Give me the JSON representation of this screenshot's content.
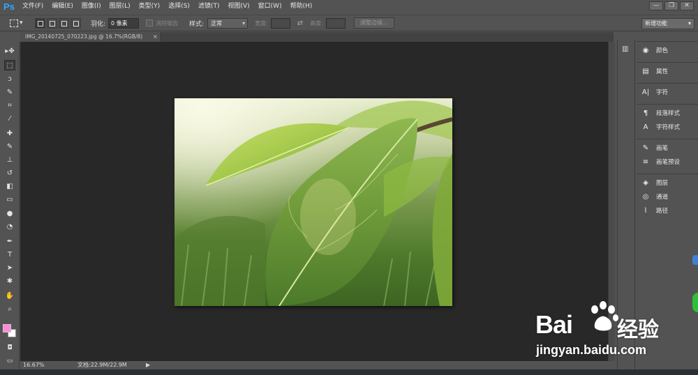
{
  "app": {
    "logo": "Ps"
  },
  "menubar": {
    "items": [
      "文件(F)",
      "编辑(E)",
      "图像(I)",
      "图层(L)",
      "类型(Y)",
      "选择(S)",
      "滤镜(T)",
      "视图(V)",
      "窗口(W)",
      "帮助(H)"
    ]
  },
  "window_controls": {
    "minimize": "—",
    "restore": "❐",
    "close": "✕"
  },
  "options": {
    "feather_label": "羽化:",
    "feather_value": "0 像素",
    "antialias_label": "消除锯齿",
    "style_label": "样式:",
    "style_value": "正常",
    "width_label": "宽度:",
    "height_label": "高度:",
    "refine_edge": "调整边缘...",
    "workspace": "新增功能"
  },
  "document": {
    "tab_title": "IMG_20140725_070223.jpg @ 16.7%(RGB/8)",
    "tab_close": "×"
  },
  "status": {
    "zoom": "16.67%",
    "doc_size": "文档:22.9M/22.9M",
    "arrow": "▶"
  },
  "panels": {
    "groups": [
      {
        "items": [
          {
            "icon": "palette-icon",
            "glyph": "◉",
            "label": "颜色"
          }
        ]
      },
      {
        "items": [
          {
            "icon": "properties-icon",
            "glyph": "▤",
            "label": "属性"
          }
        ]
      },
      {
        "items": [
          {
            "icon": "character-icon",
            "glyph": "A|",
            "label": "字符"
          }
        ]
      },
      {
        "items": [
          {
            "icon": "paragraph-style-icon",
            "glyph": "¶",
            "label": "段落样式"
          },
          {
            "icon": "character-style-icon",
            "glyph": "A",
            "label": "字符样式"
          }
        ]
      },
      {
        "items": [
          {
            "icon": "brush-icon",
            "glyph": "✎",
            "label": "画笔"
          },
          {
            "icon": "brush-presets-icon",
            "glyph": "≡",
            "label": "画笔预设"
          }
        ]
      },
      {
        "items": [
          {
            "icon": "layers-icon",
            "glyph": "◈",
            "label": "图层"
          },
          {
            "icon": "channels-icon",
            "glyph": "◎",
            "label": "通道"
          },
          {
            "icon": "paths-icon",
            "glyph": "⌇",
            "label": "路径"
          }
        ]
      }
    ]
  },
  "tools": [
    {
      "icon": "move-tool-icon",
      "glyph": "▸✥"
    },
    {
      "icon": "marquee-tool-icon",
      "glyph": "⬚"
    },
    {
      "icon": "lasso-tool-icon",
      "glyph": "ↄ"
    },
    {
      "icon": "quick-select-tool-icon",
      "glyph": "✎"
    },
    {
      "icon": "crop-tool-icon",
      "glyph": "⌗"
    },
    {
      "icon": "eyedropper-tool-icon",
      "glyph": "⁄"
    },
    {
      "icon": "healing-brush-tool-icon",
      "glyph": "✚"
    },
    {
      "icon": "brush-tool-icon",
      "glyph": "✎"
    },
    {
      "icon": "stamp-tool-icon",
      "glyph": "⊥"
    },
    {
      "icon": "history-brush-tool-icon",
      "glyph": "↺"
    },
    {
      "icon": "eraser-tool-icon",
      "glyph": "◧"
    },
    {
      "icon": "gradient-tool-icon",
      "glyph": "▭"
    },
    {
      "icon": "blur-tool-icon",
      "glyph": "●"
    },
    {
      "icon": "dodge-tool-icon",
      "glyph": "◔"
    },
    {
      "icon": "pen-tool-icon",
      "glyph": "✒"
    },
    {
      "icon": "type-tool-icon",
      "glyph": "T"
    },
    {
      "icon": "path-select-tool-icon",
      "glyph": "➤"
    },
    {
      "icon": "shape-tool-icon",
      "glyph": "✱"
    },
    {
      "icon": "hand-tool-icon",
      "glyph": "✋"
    },
    {
      "icon": "zoom-tool-icon",
      "glyph": "⌕"
    }
  ],
  "colors": {
    "foreground": "#ff8ad8",
    "background": "#ffffff",
    "ui_bg": "#535353",
    "canvas_bg": "#282828"
  },
  "watermark": {
    "brand": "Bai",
    "cn": "经验",
    "url": "jingyan.baidu.com"
  }
}
